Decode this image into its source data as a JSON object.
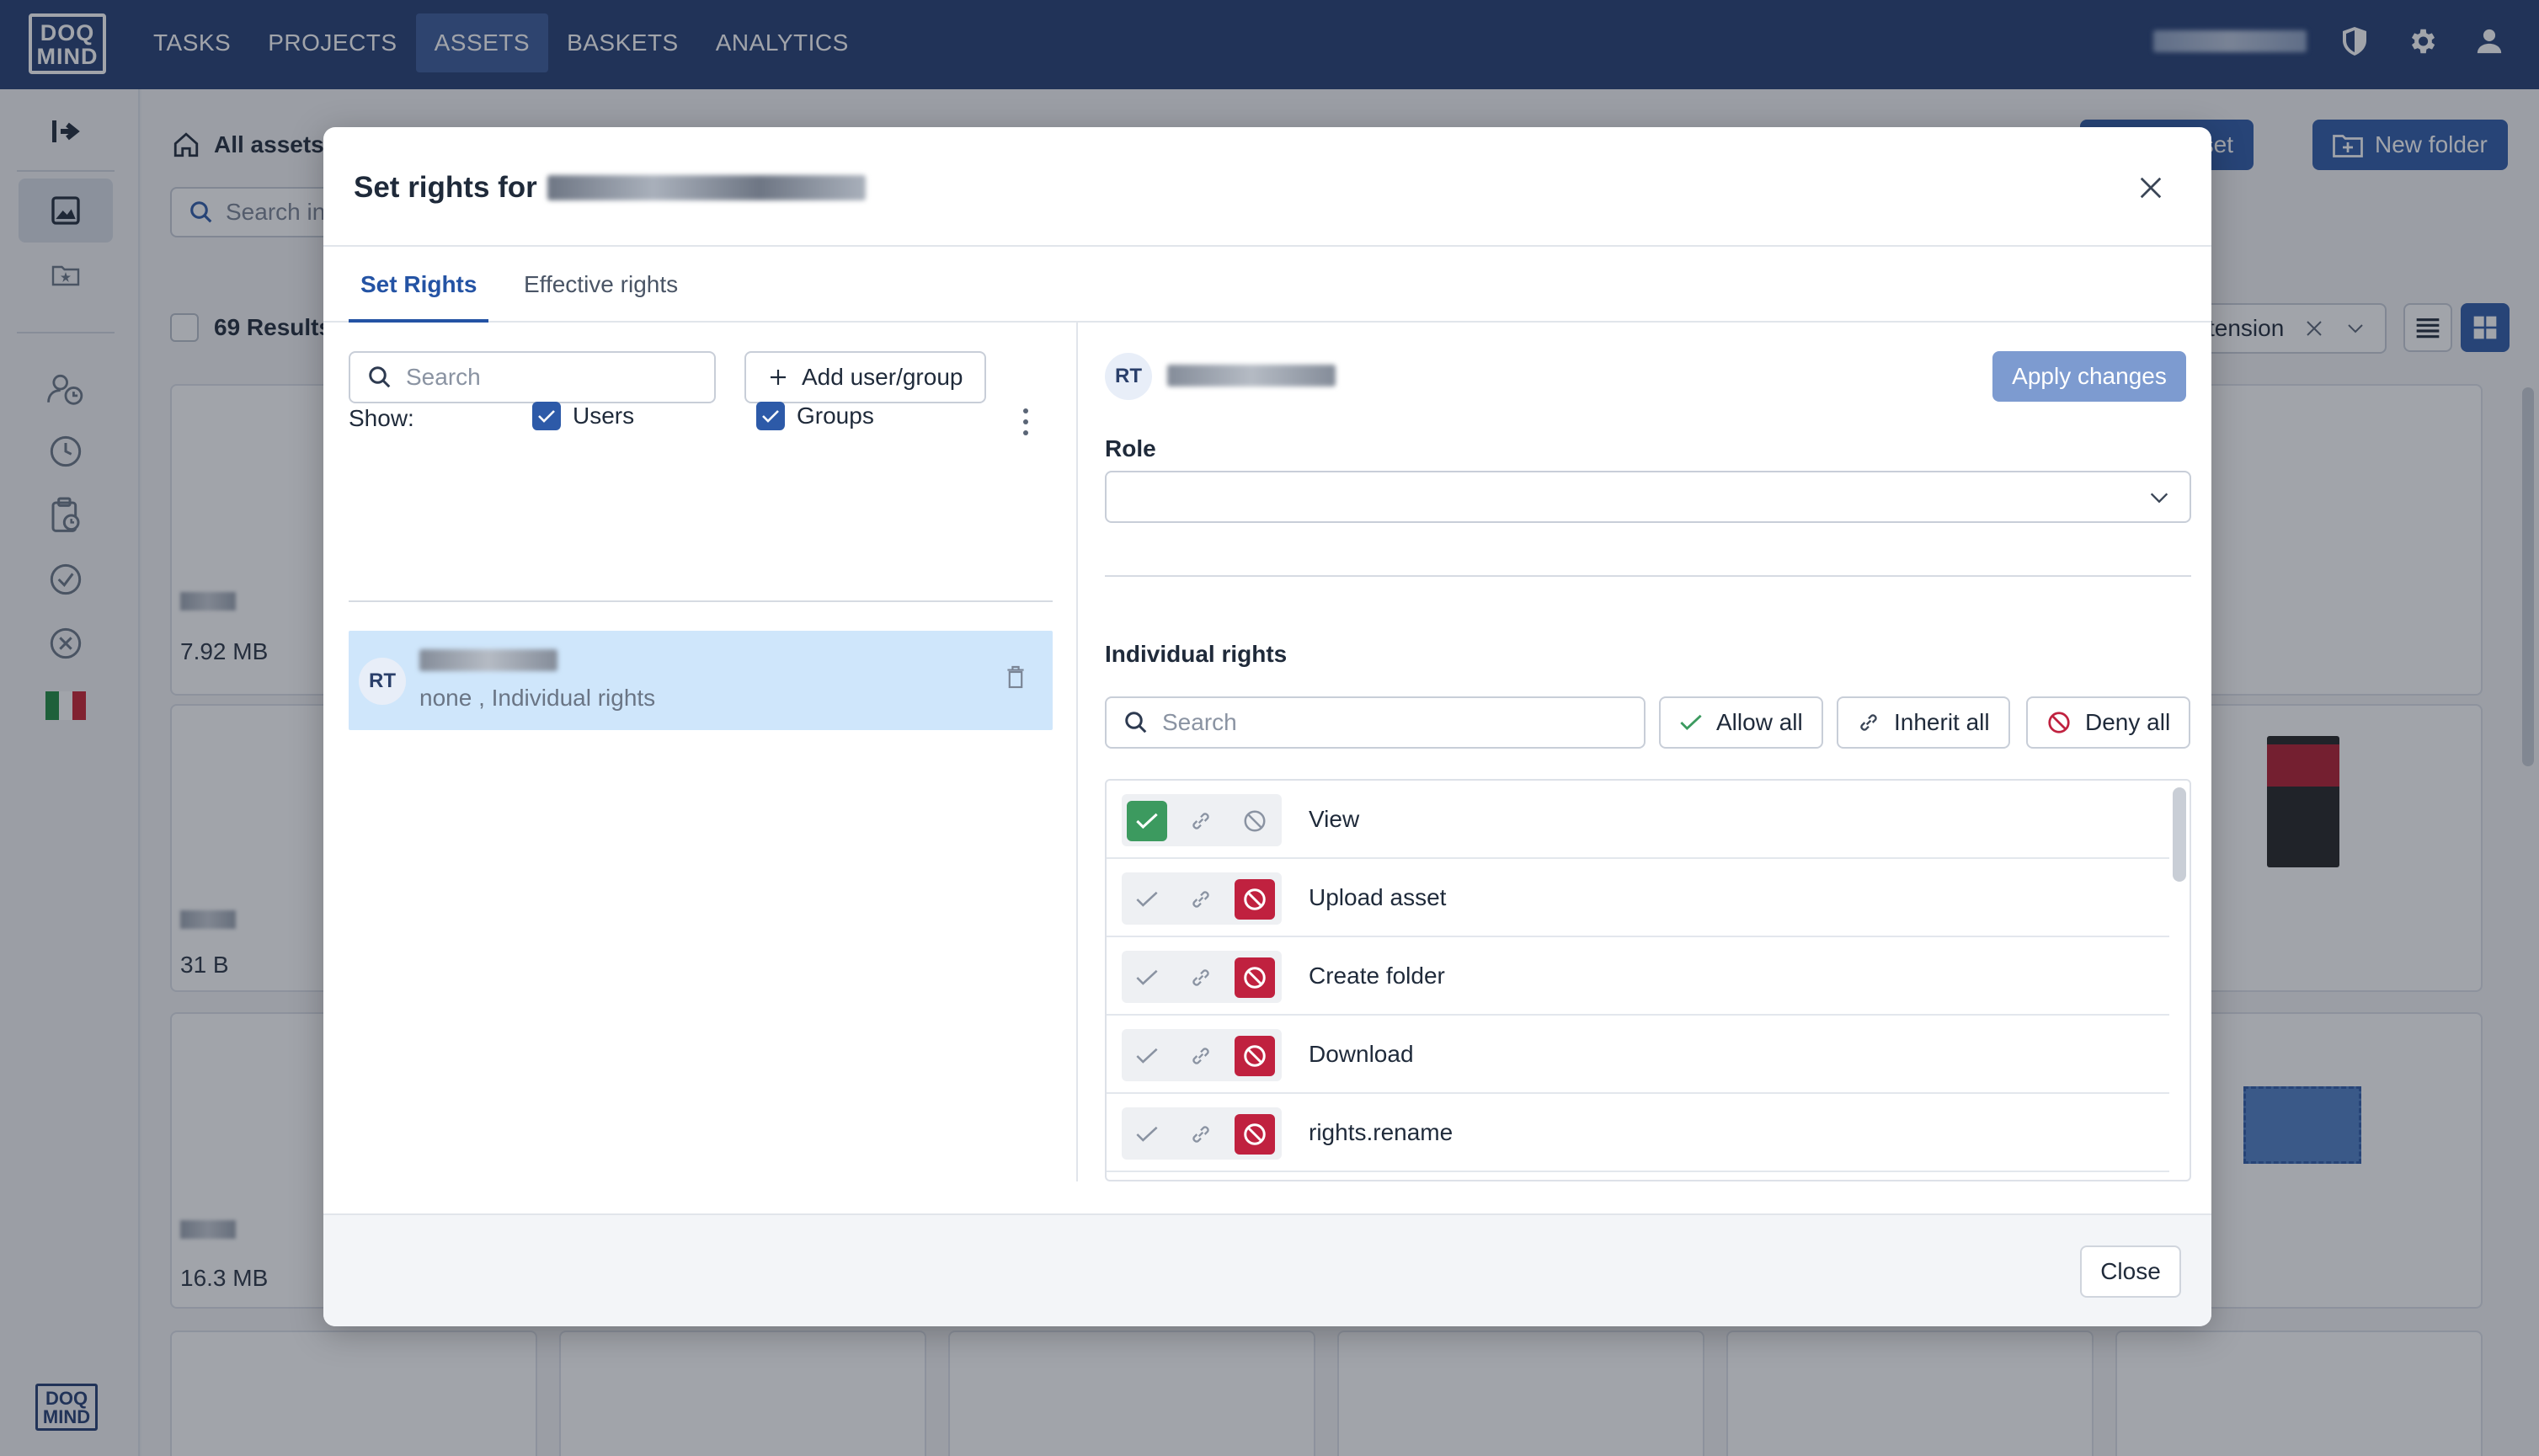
{
  "app": {
    "logo_line1": "DOQ",
    "logo_line2": "MIND"
  },
  "nav": {
    "items": [
      {
        "label": "TASKS"
      },
      {
        "label": "PROJECTS"
      },
      {
        "label": "ASSETS",
        "active": true
      },
      {
        "label": "BASKETS"
      },
      {
        "label": "ANALYTICS"
      }
    ],
    "icons": [
      "shield-icon",
      "gear-icon",
      "user-icon"
    ]
  },
  "background": {
    "breadcrumb": "All assets",
    "search_placeholder": "Search in",
    "results_label": "69 Results",
    "upload_label": "d asset",
    "new_folder_label": "New folder",
    "filter_label": "tension",
    "cards": [
      {
        "size": "7.92 MB"
      },
      {
        "size": "31 B"
      },
      {
        "size": "16.3 MB"
      }
    ]
  },
  "modal": {
    "title_prefix": "Set rights for",
    "tabs": [
      {
        "label": "Set Rights",
        "active": true
      },
      {
        "label": "Effective rights"
      }
    ],
    "left": {
      "search_placeholder": "Search",
      "add_button": "Add user/group",
      "show_label": "Show:",
      "users_label": "Users",
      "groups_label": "Groups",
      "selected_user": {
        "initials": "RT",
        "subtitle": "none , Individual rights"
      }
    },
    "right": {
      "initials": "RT",
      "apply_button": "Apply changes",
      "role_label": "Role",
      "role_value": "",
      "individual_rights_label": "Individual rights",
      "search_placeholder": "Search",
      "allow_all": "Allow all",
      "inherit_all": "Inherit all",
      "deny_all": "Deny all",
      "rights": [
        {
          "label": "View",
          "state": "allow"
        },
        {
          "label": "Upload asset",
          "state": "deny"
        },
        {
          "label": "Create folder",
          "state": "deny"
        },
        {
          "label": "Download",
          "state": "deny"
        },
        {
          "label": "rights.rename",
          "state": "deny"
        }
      ]
    },
    "close_button": "Close"
  },
  "colors": {
    "nav_bg": "#233d73",
    "primary": "#2d5aa8",
    "allow": "#3c9a5f",
    "deny": "#c0213f",
    "selected_row": "#cfe6fb"
  }
}
